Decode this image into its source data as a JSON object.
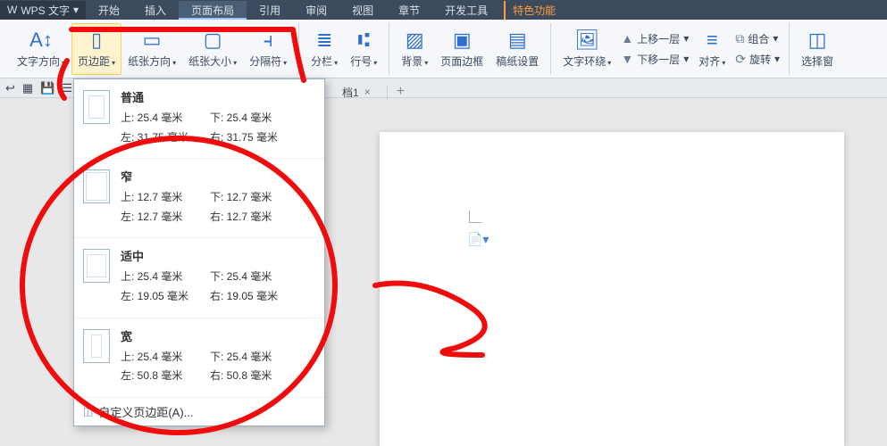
{
  "app": {
    "name": "WPS 文字",
    "caret": "▾"
  },
  "menu": {
    "items": [
      "开始",
      "插入",
      "页面布局",
      "引用",
      "审阅",
      "视图",
      "章节",
      "开发工具"
    ],
    "active_index": 2,
    "special": "特色功能"
  },
  "ribbon": {
    "text_direction": "文字方向",
    "margins": "页边距",
    "orientation": "纸张方向",
    "size": "纸张大小",
    "breaks": "分隔符",
    "columns": "分栏",
    "line_numbers": "行号",
    "background": "背景",
    "page_border": "页面边框",
    "manuscript": "稿纸设置",
    "text_wrap": "文字环绕",
    "bring_forward": "上移一层",
    "send_backward": "下移一层",
    "align": "对齐",
    "group": "组合",
    "rotate": "旋转",
    "selection_pane": "选择窗"
  },
  "quick": {
    "icons": [
      "↩",
      "▦",
      "💾",
      "☰"
    ]
  },
  "tabs": {
    "doc": "档1",
    "close": "×",
    "new": "+"
  },
  "dropdown": {
    "presets": [
      {
        "name": "普通",
        "thumb": "normal",
        "top": "上: 25.4 毫米",
        "bottom": "下: 25.4 毫米",
        "left": "左: 31.75 毫米",
        "right": "右: 31.75 毫米"
      },
      {
        "name": "窄",
        "thumb": "narrow",
        "top": "上: 12.7 毫米",
        "bottom": "下: 12.7 毫米",
        "left": "左: 12.7 毫米",
        "right": "右: 12.7 毫米"
      },
      {
        "name": "适中",
        "thumb": "moderate",
        "top": "上: 25.4 毫米",
        "bottom": "下: 25.4 毫米",
        "left": "左: 19.05 毫米",
        "right": "右: 19.05 毫米"
      },
      {
        "name": "宽",
        "thumb": "wide",
        "top": "上: 25.4 毫米",
        "bottom": "下: 25.4 毫米",
        "left": "左: 50.8 毫米",
        "right": "右: 50.8 毫米"
      }
    ],
    "custom": "自定义页边距(A)..."
  }
}
